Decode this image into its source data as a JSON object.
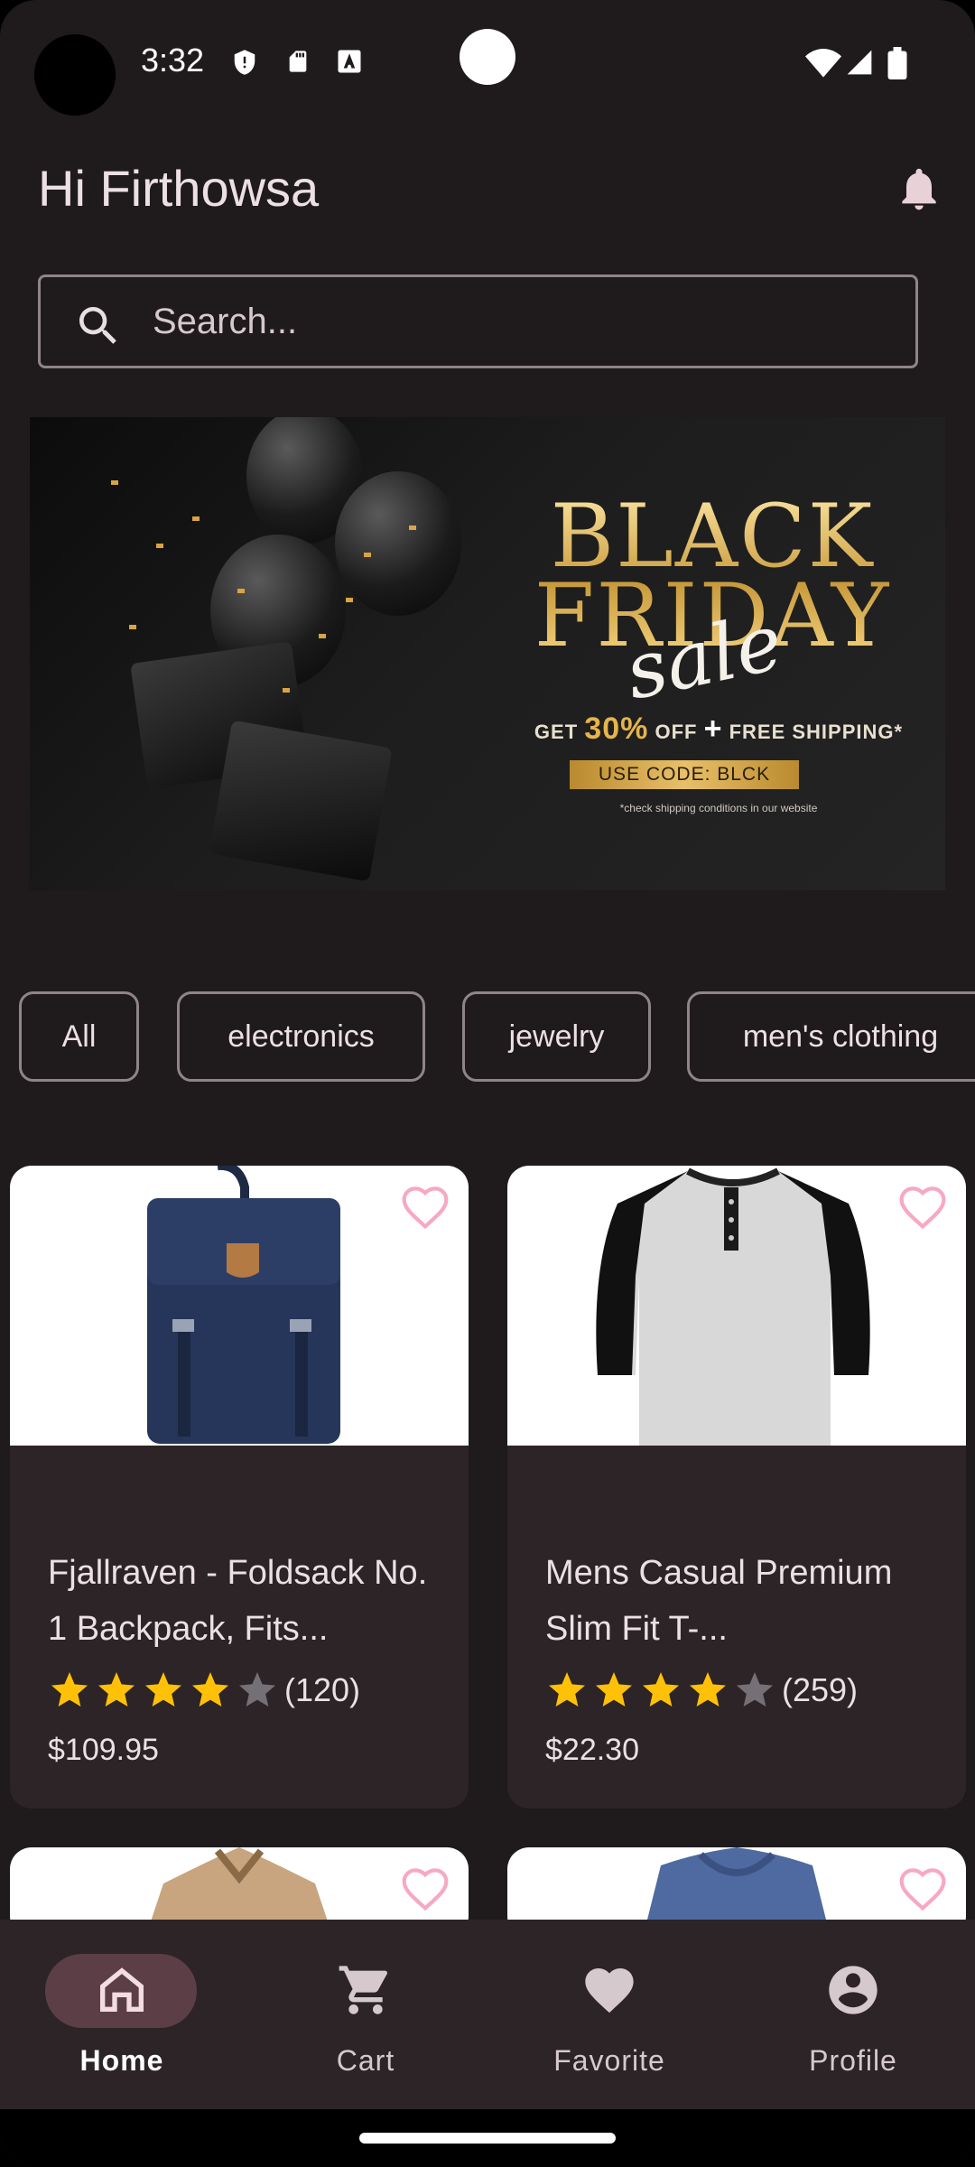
{
  "status_bar": {
    "time": "3:32"
  },
  "header": {
    "greeting": "Hi Firthowsa"
  },
  "search": {
    "placeholder": "Search..."
  },
  "banner": {
    "headline": "BLACK FRIDAY",
    "script": "sale",
    "offer_prefix": "GET",
    "offer_percent": "30%",
    "offer_suffix": "OFF",
    "offer_plus": "+",
    "offer_shipping": "FREE SHIPPING*",
    "code": "USE CODE: BLCK",
    "note": "*check shipping conditions in our website"
  },
  "categories": [
    "All",
    "electronics",
    "jewelry",
    "men's clothing"
  ],
  "products": [
    {
      "title": "Fjallraven - Foldsack No. 1 Backpack, Fits...",
      "rating_count": "(120)",
      "rating": 4,
      "price": "$109.95"
    },
    {
      "title": "Mens Casual Premium Slim Fit T-...",
      "rating_count": "(259)",
      "rating": 4,
      "price": "$22.30"
    }
  ],
  "nav": {
    "items": [
      {
        "label": "Home",
        "icon": "home-icon",
        "active": true
      },
      {
        "label": "Cart",
        "icon": "cart-icon",
        "active": false
      },
      {
        "label": "Favorite",
        "icon": "heart-icon",
        "active": false
      },
      {
        "label": "Profile",
        "icon": "account-icon",
        "active": false
      }
    ]
  },
  "colors": {
    "background": "#1f1a1c",
    "card": "#2c2427",
    "star": "#ffc107",
    "favorite_outline": "#f7a8c4",
    "nav_active_pill": "#5c3f46"
  }
}
